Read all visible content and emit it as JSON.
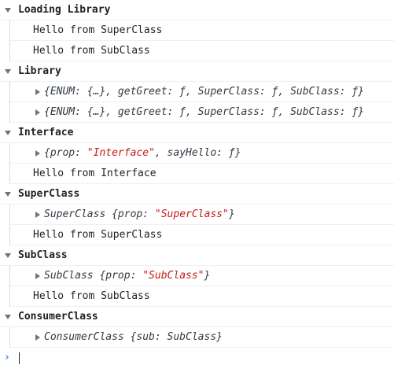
{
  "groups": [
    {
      "title": "Loading Library",
      "rows": [
        {
          "type": "text",
          "text": "Hello from SuperClass"
        },
        {
          "type": "text",
          "text": "Hello from SubClass"
        }
      ]
    },
    {
      "title": "Library",
      "rows": [
        {
          "type": "object",
          "text": "{ENUM: {…}, getGreet: ƒ, SuperClass: ƒ, SubClass: ƒ}"
        },
        {
          "type": "object",
          "text": "{ENUM: {…}, getGreet: ƒ, SuperClass: ƒ, SubClass: ƒ}"
        }
      ]
    },
    {
      "title": "Interface",
      "rows": [
        {
          "type": "object",
          "pre": "{prop: ",
          "str": "\"Interface\"",
          "post": ", sayHello: ƒ}"
        },
        {
          "type": "text",
          "text": "Hello from Interface"
        }
      ]
    },
    {
      "title": "SuperClass",
      "rows": [
        {
          "type": "object",
          "pre": "SuperClass {prop: ",
          "str": "\"SuperClass\"",
          "post": "}"
        },
        {
          "type": "text",
          "text": "Hello from SuperClass"
        }
      ]
    },
    {
      "title": "SubClass",
      "rows": [
        {
          "type": "object",
          "pre": "SubClass {prop: ",
          "str": "\"SubClass\"",
          "post": "}"
        },
        {
          "type": "text",
          "text": "Hello from SubClass"
        }
      ]
    },
    {
      "title": "ConsumerClass",
      "rows": [
        {
          "type": "object",
          "text": "ConsumerClass {sub: SubClass}"
        }
      ]
    }
  ],
  "prompt": {
    "symbol": "›",
    "value": ""
  },
  "colors": {
    "string": "#c41a16",
    "prompt": "#367cf1",
    "triangle": "#727272"
  }
}
